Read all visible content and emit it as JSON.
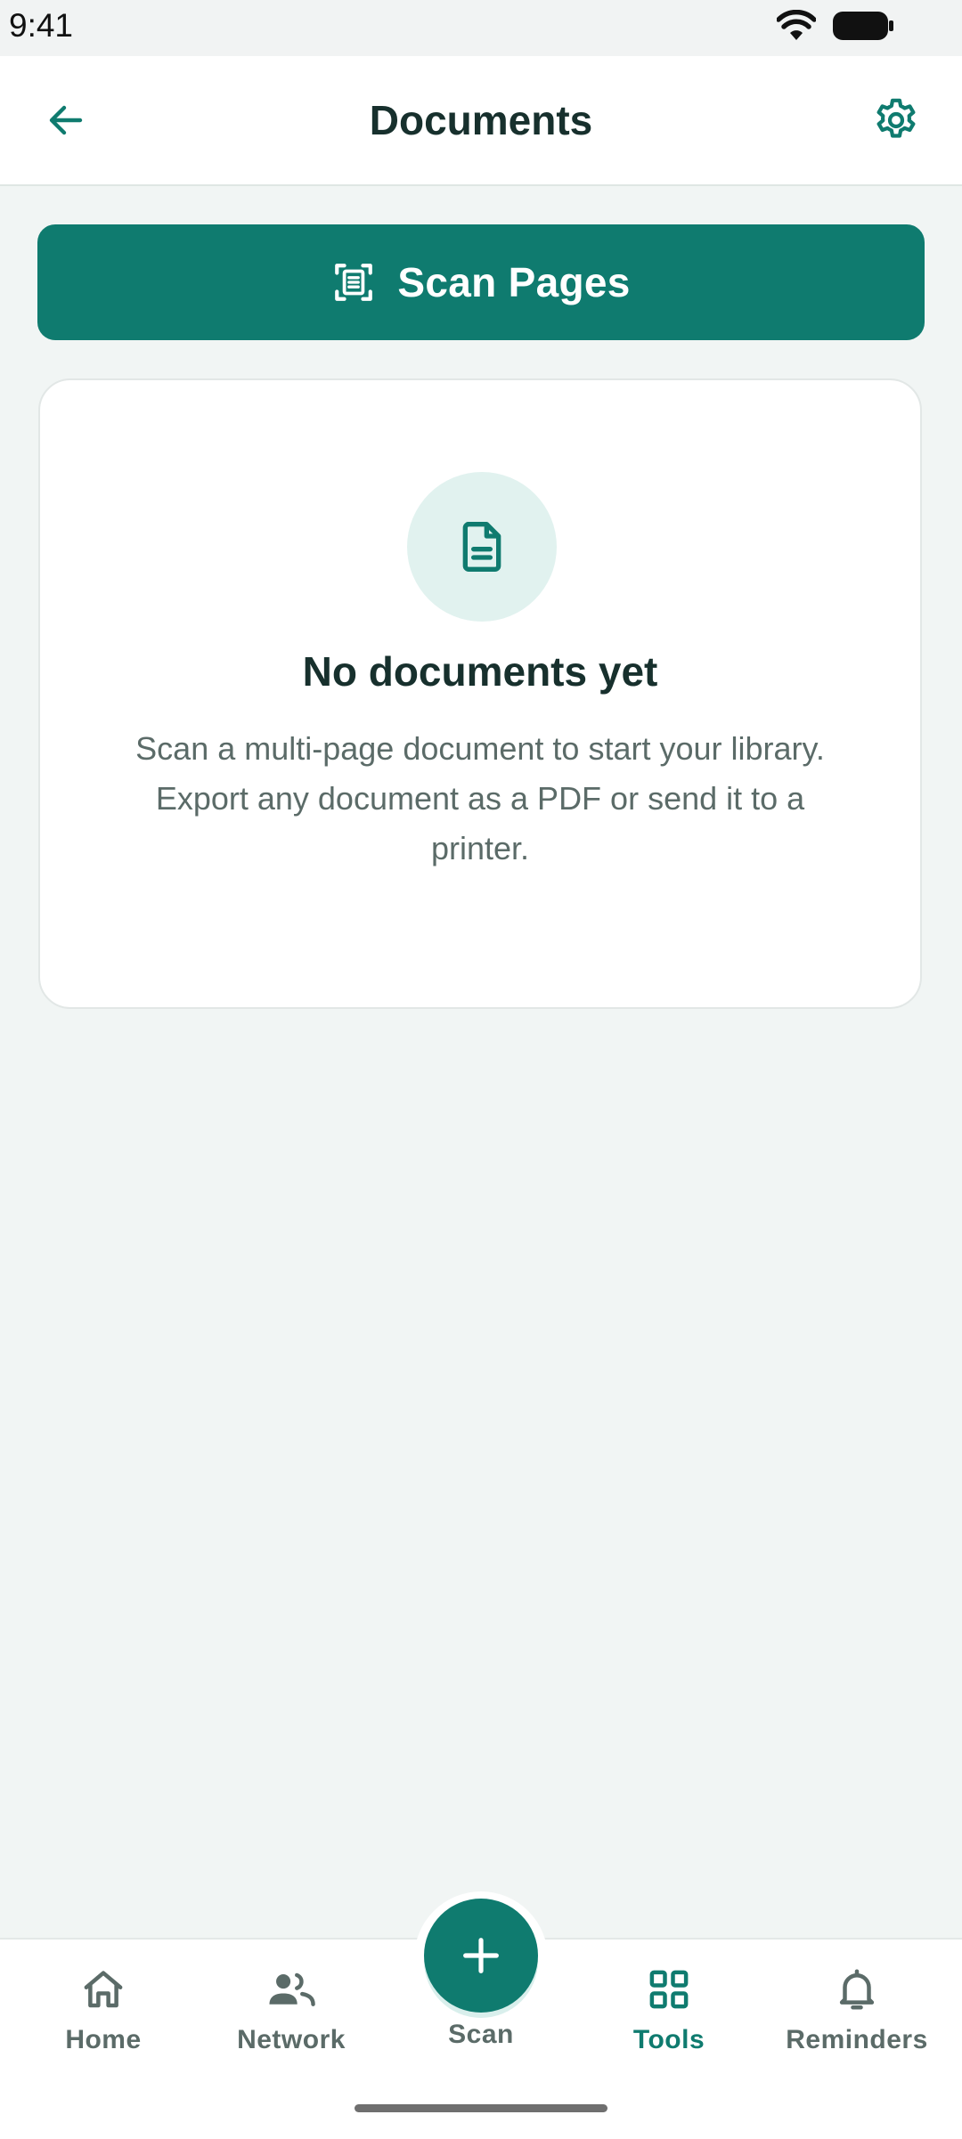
{
  "status_bar": {
    "time": "9:41",
    "icons": [
      "wifi-icon",
      "battery-icon"
    ]
  },
  "header": {
    "title": "Documents",
    "back_icon": "arrow-left-icon",
    "settings_icon": "gear-icon"
  },
  "scan_button": {
    "label": "Scan Pages",
    "icon": "document-scan-icon"
  },
  "empty_state": {
    "icon": "document-icon",
    "title": "No documents yet",
    "line1": "Scan a multi-page document to start your library.",
    "line2": "Export any document as a PDF or send it to a printer."
  },
  "bottom_nav": {
    "items": [
      {
        "label": "Home",
        "icon": "home-icon",
        "active": false
      },
      {
        "label": "Network",
        "icon": "people-icon",
        "active": false
      },
      {
        "label": "Scan",
        "icon": "plus-icon",
        "active": false
      },
      {
        "label": "Tools",
        "icon": "grid-icon",
        "active": true
      },
      {
        "label": "Reminders",
        "icon": "bell-icon",
        "active": false
      }
    ]
  },
  "colors": {
    "accent": "#0f7b6f",
    "accent_light": "#e1f2ef",
    "background": "#f1f5f4",
    "text_primary": "#17302d",
    "text_secondary": "#5b6b68"
  }
}
